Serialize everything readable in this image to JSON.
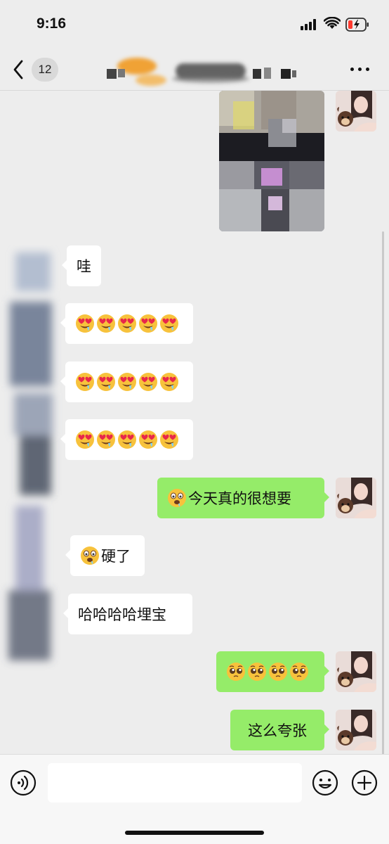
{
  "status": {
    "time": "9:16"
  },
  "nav": {
    "unread_count": "12"
  },
  "messages": {
    "m1": "哇",
    "m5_text": "今天真的很想要",
    "m6_text": "硬了",
    "m7": "哈哈哈哈埋宝",
    "m9": "这么夸张"
  },
  "input": {
    "placeholder": ""
  },
  "icons": {
    "back": "chevron-left-icon",
    "more": "more-dots-icon",
    "voice": "voice-icon",
    "emoji": "emoji-icon",
    "plus": "plus-icon",
    "heart_eyes": "heart-eyes-drool-emoji",
    "drool": "drooling-emoji",
    "pleading": "pleading-emoji"
  },
  "colors": {
    "background": "#ededed",
    "bubble_out": "#95ec69",
    "bubble_in": "#ffffff"
  }
}
